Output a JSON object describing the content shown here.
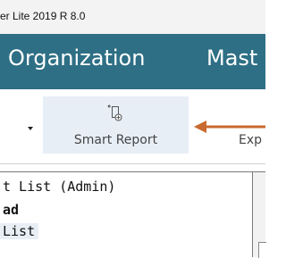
{
  "window": {
    "title": "er Lite 2019 R 8.0"
  },
  "menu": {
    "items": [
      {
        "label": "Organization"
      },
      {
        "label": "Mast"
      }
    ]
  },
  "ribbon": {
    "smart_report": {
      "label": "Smart Report",
      "icon": "smart-report-icon"
    },
    "next_button": {
      "label": "Exp"
    }
  },
  "tree": {
    "rows": [
      {
        "label": "t List (Admin)"
      },
      {
        "label": "ad"
      },
      {
        "label": "List"
      }
    ]
  },
  "colors": {
    "menubar": "#2e6f85",
    "annotation_arrow": "#c8692e",
    "ribbon_highlight": "#e8eef6"
  }
}
